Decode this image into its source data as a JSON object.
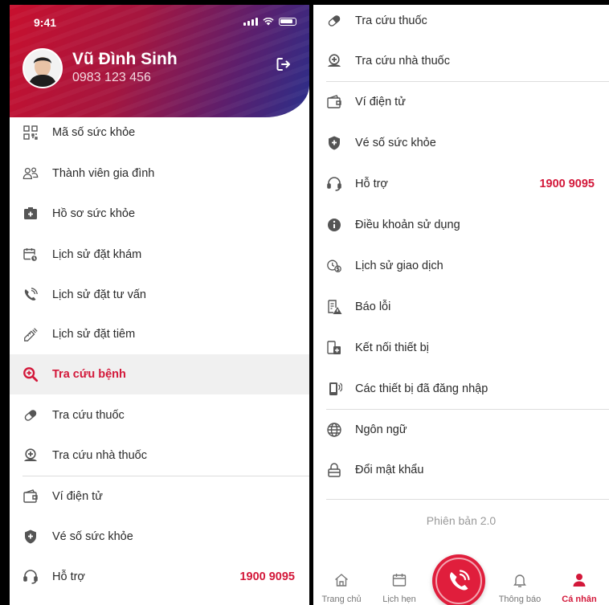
{
  "status": {
    "time": "9:41"
  },
  "user": {
    "name": "Vũ Đình Sinh",
    "phone": "0983 123 456"
  },
  "left_menu": [
    {
      "label": "Mã số sức khỏe",
      "icon": "qr-code-icon"
    },
    {
      "label": "Thành viên gia đình",
      "icon": "family-icon"
    },
    {
      "label": "Hồ sơ sức khỏe",
      "icon": "health-record-icon"
    },
    {
      "label": "Lịch sử đặt khám",
      "icon": "calendar-clock-icon"
    },
    {
      "label": "Lịch sử đặt tư vấn",
      "icon": "phone-consult-icon"
    },
    {
      "label": "Lịch sử đặt tiêm",
      "icon": "syringe-icon"
    },
    {
      "label": "Tra cứu bệnh",
      "icon": "disease-search-icon"
    },
    {
      "label": "Tra cứu thuốc",
      "icon": "pill-icon"
    },
    {
      "label": "Tra cứu nhà thuốc",
      "icon": "pharmacy-location-icon"
    },
    {
      "label": "Ví điện tử",
      "icon": "wallet-icon"
    },
    {
      "label": "Vé số sức khỏe",
      "icon": "shield-plus-icon"
    },
    {
      "label": "Hỗ trợ",
      "icon": "headset-icon",
      "value": "1900 9095"
    }
  ],
  "right_menu": [
    {
      "label": "Tra cứu thuốc",
      "icon": "pill-icon"
    },
    {
      "label": "Tra cứu nhà thuốc",
      "icon": "pharmacy-location-icon"
    },
    {
      "label": "Ví điện tử",
      "icon": "wallet-icon"
    },
    {
      "label": "Vé số sức khỏe",
      "icon": "shield-plus-icon"
    },
    {
      "label": "Hỗ trợ",
      "icon": "headset-icon",
      "value": "1900 9095"
    },
    {
      "label": "Điều khoản sử dụng",
      "icon": "info-icon"
    },
    {
      "label": "Lịch sử giao dịch",
      "icon": "transaction-history-icon"
    },
    {
      "label": "Báo lỗi",
      "icon": "report-bug-icon"
    },
    {
      "label": "Kết nối thiết bị",
      "icon": "device-connect-icon"
    },
    {
      "label": "Các thiết bị đã đăng nhập",
      "icon": "logged-devices-icon"
    },
    {
      "label": "Ngôn ngữ",
      "icon": "globe-icon"
    },
    {
      "label": "Đổi mật khẩu",
      "icon": "lock-icon"
    }
  ],
  "version": "Phiên bản 2.0",
  "bottom_nav": {
    "home": "Trang chủ",
    "schedule": "Lịch hẹn",
    "notifications": "Thông báo",
    "profile": "Cá nhân"
  },
  "colors": {
    "accent": "#d3183a",
    "header_start": "#c8102e",
    "header_end": "#2a2f8a"
  }
}
